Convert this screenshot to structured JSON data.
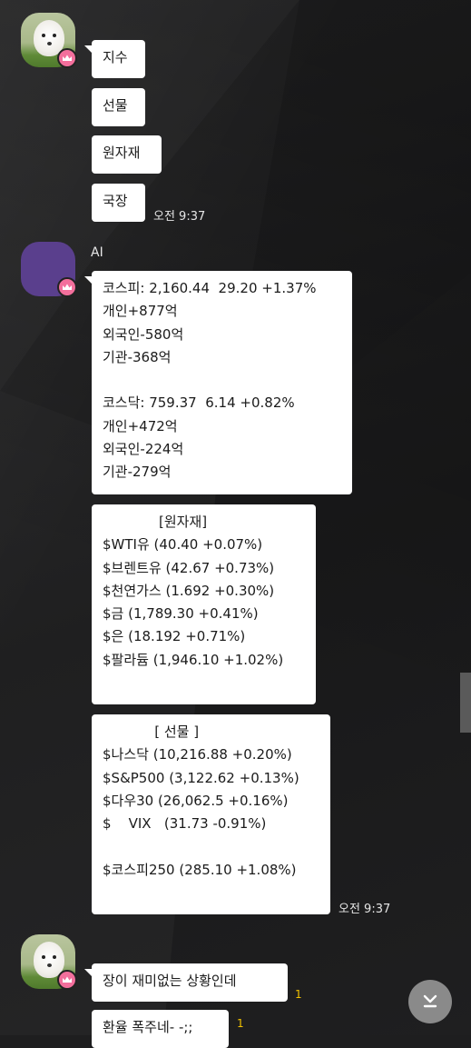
{
  "chat": {
    "group1": {
      "messages": [
        "지수",
        "선물",
        "원자재",
        "국장"
      ],
      "time": "오전 9:37"
    },
    "group2": {
      "sender": "AI",
      "msg1_lines": [
        "코스피: 2,160.44  29.20 +1.37%",
        "개인+877억",
        "외국인-580억",
        "기관-368억",
        "",
        "코스닥: 759.37  6.14 +0.82%",
        "개인+472억",
        "외국인-224억",
        "기관-279억"
      ],
      "msg2_lines": [
        "             [원자재]",
        "$WTI유 (40.40 +0.07%)",
        "$브렌트유 (42.67 +0.73%)",
        "$천연가스 (1.692 +0.30%)",
        "$금 (1,789.30 +0.41%)",
        "$은 (18.192 +0.71%)",
        "$팔라듐 (1,946.10 +1.02%)",
        ""
      ],
      "msg3_lines": [
        "            [ 선물 ]",
        "$나스닥 (10,216.88 +0.20%)",
        "$S&P500 (3,122.62 +0.13%)",
        "$다우30 (26,062.5 +0.16%)",
        "$    VIX   (31.73 -0.91%)",
        "",
        "$코스피250 (285.10 +1.08%)",
        ""
      ],
      "time": "오전 9:37"
    },
    "group3": {
      "msg1": "장이 재미없는 상황인데",
      "msg1_unread": "1",
      "msg2": "환율 폭주네- -;;",
      "msg2_unread": "1"
    }
  },
  "icons": {
    "crown": "crown-icon",
    "scroll_down": "arrow-down-to-bottom-icon"
  },
  "colors": {
    "background": "#1e1e1f",
    "bubble": "#ffffff",
    "unread": "#f2c200",
    "badge": "#f36f9c",
    "ai_avatar": "#5a3f8d"
  }
}
